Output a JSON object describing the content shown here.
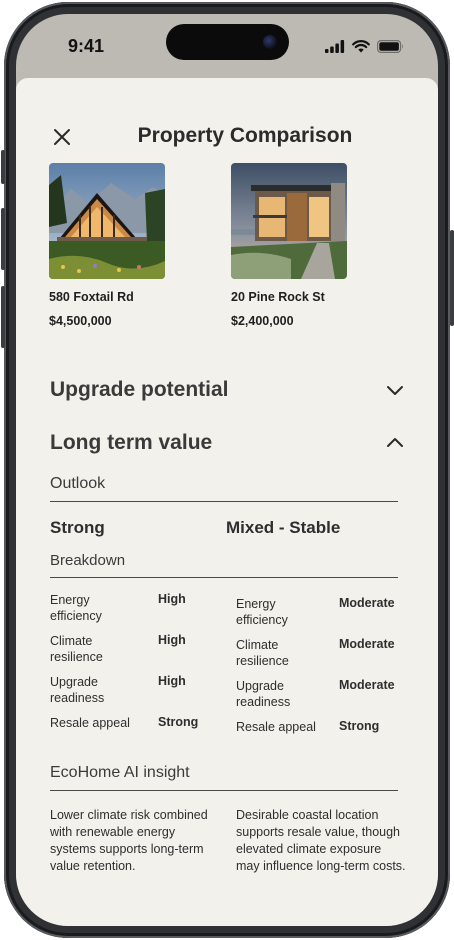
{
  "status_bar": {
    "time": "9:41"
  },
  "header": {
    "title": "Property Comparison"
  },
  "properties": [
    {
      "address": "580 Foxtail Rd",
      "price": "$4,500,000"
    },
    {
      "address": "20 Pine Rock St",
      "price": "$2,400,000"
    }
  ],
  "sections": {
    "upgrade": {
      "title": "Upgrade potential",
      "icon": "chevron-down-icon"
    },
    "long_term": {
      "title": "Long term value",
      "icon": "chevron-up-icon"
    }
  },
  "outlook": {
    "label": "Outlook",
    "values": [
      "Strong",
      "Mixed - Stable"
    ]
  },
  "breakdown": {
    "label": "Breakdown",
    "left": [
      {
        "metric": "Energy efficiency",
        "value": "High"
      },
      {
        "metric": "Climate resilience",
        "value": "High"
      },
      {
        "metric": "Upgrade readiness",
        "value": "High"
      },
      {
        "metric": "Resale appeal",
        "value": "Strong"
      }
    ],
    "right": [
      {
        "metric": "Energy efficiency",
        "value": "Moderate"
      },
      {
        "metric": "Climate resilience",
        "value": "Moderate"
      },
      {
        "metric": "Upgrade readiness",
        "value": "Moderate"
      },
      {
        "metric": "Resale appeal",
        "value": "Strong"
      }
    ]
  },
  "insight": {
    "label": "EcoHome AI insight",
    "left": "Lower climate risk combined with renewable energy systems supports long-term value retention.",
    "right": "Desirable coastal location supports resale value, though elevated climate exposure may influence long-term costs."
  },
  "colors": {
    "sheet_bg": "#f3f1eb",
    "text": "#2e2e2e",
    "frame": "#2f3134"
  }
}
